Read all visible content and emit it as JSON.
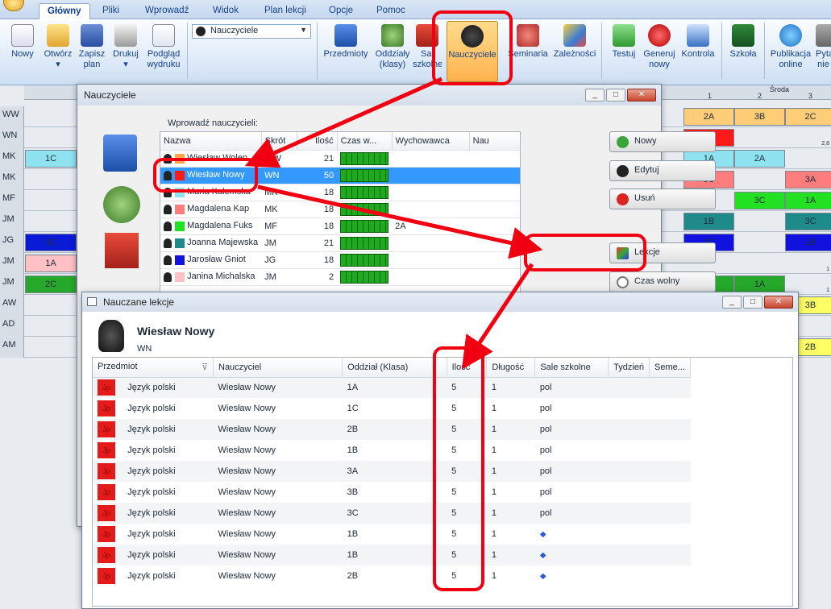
{
  "ribbon_tabs": [
    "Główny",
    "Pliki",
    "Wprowadź",
    "Widok",
    "Plan lekcji",
    "Opcje",
    "Pomoc"
  ],
  "ribbon_buttons": {
    "nowy": "Nowy",
    "otworz": "Otwórz",
    "zapisz": "Zapisz",
    "zapisz2": "plan",
    "drukuj": "Drukuj",
    "podglad": "Podgląd",
    "podglad2": "wydruku",
    "przedmioty": "Przedmioty",
    "oddzialy": "Oddziały",
    "oddzialy2": "(klasy)",
    "sale": "Sal",
    "sale2": "szkolne",
    "nauczyciele": "Nauczyciele",
    "seminaria": "Seminaria",
    "zaleznosci": "Zależności",
    "testuj": "Testuj",
    "generuj": "Generuj",
    "generuj2": "nowy",
    "kontrola": "Kontrola",
    "szkola": "Szkoła",
    "publikacja": "Publikacja",
    "publikacja2": "online",
    "pyt": "Pyta",
    "pyt2": "nie"
  },
  "combo_value": "Nauczyciele",
  "grid": {
    "rows": [
      "WW",
      "WN",
      "MK",
      "MK",
      "MF",
      "JM",
      "JG",
      "JM",
      "JM",
      "AW",
      "AD",
      "AM"
    ],
    "subs": [
      "",
      "2,8",
      "",
      "1",
      "1",
      "1",
      "1",
      "1",
      "1",
      "",
      "",
      ""
    ],
    "left_cells": [
      {
        "row": 2,
        "text": "1C",
        "color": "#8fe3f0"
      },
      {
        "row": 6,
        "text": "3C",
        "color": "#0a1bd6"
      },
      {
        "row": 7,
        "text": "1A",
        "color": "#ffc1c4"
      },
      {
        "row": 8,
        "text": "2C",
        "color": "#26a82a"
      }
    ],
    "day_label": "Środa",
    "col_heads": [
      "1",
      "2",
      "3"
    ],
    "right_cells": [
      {
        "row": 0,
        "col": 0,
        "text": "2A",
        "color": "#ffcc77"
      },
      {
        "row": 0,
        "col": 1,
        "text": "3B",
        "color": "#ffcc77"
      },
      {
        "row": 0,
        "col": 2,
        "text": "2C",
        "color": "#ffcc77"
      },
      {
        "row": 1,
        "col": 0,
        "text": "2B",
        "color": "#ff1a1a"
      },
      {
        "row": 2,
        "col": 0,
        "text": "1A",
        "color": "#8fe3f0"
      },
      {
        "row": 2,
        "col": 1,
        "text": "2A",
        "color": "#8fe3f0"
      },
      {
        "row": 3,
        "col": 0,
        "text": "3C",
        "color": "#ff7d7d"
      },
      {
        "row": 3,
        "col": 2,
        "text": "3A",
        "color": "#ff7d7d"
      },
      {
        "row": 4,
        "col": 1,
        "text": "3C",
        "color": "#22e022"
      },
      {
        "row": 4,
        "col": 2,
        "text": "1A",
        "color": "#22e022"
      },
      {
        "row": 5,
        "col": 0,
        "text": "1B",
        "color": "#1f8a8a"
      },
      {
        "row": 5,
        "col": 2,
        "text": "3C",
        "color": "#1f8a8a"
      },
      {
        "row": 6,
        "col": 0,
        "text": "2C",
        "color": "#1212e0"
      },
      {
        "row": 6,
        "col": 2,
        "text": "1B",
        "color": "#1212e0"
      },
      {
        "row": 8,
        "col": 0,
        "text": "3A",
        "color": "#26a82a"
      },
      {
        "row": 8,
        "col": 1,
        "text": "1A",
        "color": "#26a82a"
      },
      {
        "row": 9,
        "col": 2,
        "text": "3B",
        "color": "#ffff66"
      },
      {
        "row": 11,
        "col": 2,
        "text": "2B",
        "color": "#ffff66"
      }
    ]
  },
  "teachers_window": {
    "title": "Nauczyciele",
    "prompt": "Wprowadź nauczycieli:",
    "columns": [
      "Nazwa",
      "Skrót",
      "Ilość",
      "Czas w...",
      "Wychowawca",
      "Nau"
    ],
    "rows": [
      {
        "name": "Wiesław Wolen",
        "abbr": "WW",
        "count": "21",
        "color": "#ffa64d",
        "tutor": ""
      },
      {
        "name": "Wiesław Nowy",
        "abbr": "WN",
        "count": "50",
        "color": "#ff1a1a",
        "tutor": "",
        "selected": true
      },
      {
        "name": "Maria Kalemska",
        "abbr": "MK",
        "count": "18",
        "color": "#8fe3f0",
        "tutor": ""
      },
      {
        "name": "Magdalena Kap",
        "abbr": "MK",
        "count": "18",
        "color": "#ff7d7d",
        "tutor": ""
      },
      {
        "name": "Magdalena Fuks",
        "abbr": "MF",
        "count": "18",
        "color": "#22e022",
        "tutor": "2A"
      },
      {
        "name": "Joanna Majewska",
        "abbr": "JM",
        "count": "21",
        "color": "#1f8a8a",
        "tutor": ""
      },
      {
        "name": "Jarosław Gniot",
        "abbr": "JG",
        "count": "18",
        "color": "#1212e0",
        "tutor": ""
      },
      {
        "name": "Janina Michalska",
        "abbr": "JM",
        "count": "2",
        "color": "#ffc1c4",
        "tutor": ""
      }
    ],
    "buttons": {
      "nowy": "Nowy",
      "edytuj": "Edytuj",
      "usun": "Usuń",
      "lekcje": "Lekcje",
      "czas": "Czas wolny"
    }
  },
  "lessons_window": {
    "title": "Nauczane lekcje",
    "teacher_name": "Wiesław Nowy",
    "teacher_abbr": "WN",
    "columns": [
      "Przedmiot",
      "Nauczyciel",
      "Oddział (Klasa)",
      "Ilość",
      "Długość",
      "Sale szkolne",
      "Tydzień",
      "Seme..."
    ],
    "subject_abbr": "Jp",
    "rows": [
      {
        "subject": "Język polski",
        "teacher": "Wiesław Nowy",
        "class": "1A",
        "count": "5",
        "length": "1",
        "room": "pol"
      },
      {
        "subject": "Język polski",
        "teacher": "Wiesław Nowy",
        "class": "1C",
        "count": "5",
        "length": "1",
        "room": "pol"
      },
      {
        "subject": "Język polski",
        "teacher": "Wiesław Nowy",
        "class": "2B",
        "count": "5",
        "length": "1",
        "room": "pol"
      },
      {
        "subject": "Język polski",
        "teacher": "Wiesław Nowy",
        "class": "1B",
        "count": "5",
        "length": "1",
        "room": "pol"
      },
      {
        "subject": "Język polski",
        "teacher": "Wiesław Nowy",
        "class": "3A",
        "count": "5",
        "length": "1",
        "room": "pol"
      },
      {
        "subject": "Język polski",
        "teacher": "Wiesław Nowy",
        "class": "3B",
        "count": "5",
        "length": "1",
        "room": "pol"
      },
      {
        "subject": "Język polski",
        "teacher": "Wiesław Nowy",
        "class": "3C",
        "count": "5",
        "length": "1",
        "room": "pol"
      },
      {
        "subject": "Język polski",
        "teacher": "Wiesław Nowy",
        "class": "1B",
        "count": "5",
        "length": "1",
        "room": ""
      },
      {
        "subject": "Język polski",
        "teacher": "Wiesław Nowy",
        "class": "1B",
        "count": "5",
        "length": "1",
        "room": ""
      },
      {
        "subject": "Język polski",
        "teacher": "Wiesław Nowy",
        "class": "2B",
        "count": "5",
        "length": "1",
        "room": ""
      }
    ]
  },
  "colors": {
    "annotation": "#f00011",
    "accent": "#15428b"
  }
}
